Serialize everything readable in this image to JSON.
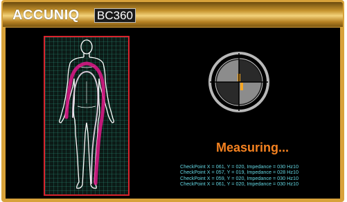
{
  "header": {
    "brand": "ACCUNIQ",
    "model": "BC360"
  },
  "status": {
    "text": "Measuring..."
  },
  "log": [
    "CheckPoint X = 061, Y = 020, Impedance = 030 Hz10",
    "CheckPoint X = 057, Y = 019, Impedance = 028 Hz10",
    "CheckPoint X = 059, Y = 020, Impedance = 030 Hz10",
    "CheckPoint X = 061, Y = 020, Impedance = 030 Hz10"
  ],
  "colors": {
    "frame": "#d8a23a",
    "panel_border": "#d9232d",
    "grid": "#2e9a82",
    "current_path": "#e0198a",
    "status": "#f58220",
    "log_text": "#64d8e4"
  },
  "icons": {
    "gauge": "measuring-gauge-icon",
    "body": "human-body-figure"
  }
}
